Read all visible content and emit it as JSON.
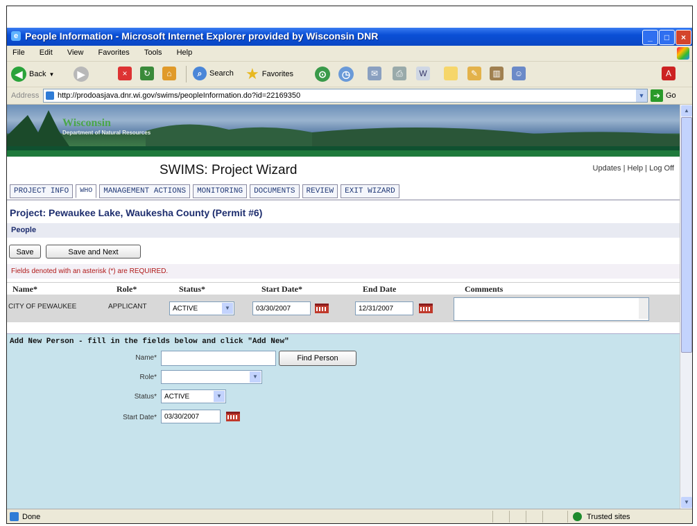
{
  "window": {
    "title": "People Information - Microsoft Internet Explorer provided by Wisconsin DNR",
    "menu": [
      "File",
      "Edit",
      "View",
      "Favorites",
      "Tools",
      "Help"
    ]
  },
  "toolbar": {
    "back_label": "Back",
    "search_label": "Search",
    "favorites_label": "Favorites"
  },
  "address": {
    "label": "Address",
    "url": "http://prodoasjava.dnr.wi.gov/swims/peopleInformation.do?id=22169350",
    "go_label": "Go"
  },
  "banner": {
    "title": "Wisconsin",
    "subtitle": "Department of Natural Resources"
  },
  "page": {
    "wizard_title": "SWIMS: Project Wizard",
    "links": [
      "Updates",
      "Help",
      "Log Off"
    ],
    "tabs": [
      "PROJECT INFO",
      "WHO",
      "MANAGEMENT ACTIONS",
      "MONITORING",
      "DOCUMENTS",
      "REVIEW",
      "EXIT WIZARD"
    ],
    "active_tab": "WHO",
    "project": "Project: Pewaukee Lake, Waukesha County (Permit #6)",
    "section": "People",
    "save_label": "Save",
    "save_next_label": "Save and Next",
    "required_note": "Fields denoted with an asterisk (*) are REQUIRED."
  },
  "people_table": {
    "columns": [
      "Name*",
      "Role*",
      "Status*",
      "Start Date*",
      "End Date",
      "Comments"
    ],
    "rows": [
      {
        "name": "CITY OF PEWAUKEE",
        "role": "APPLICANT",
        "status": "ACTIVE",
        "start": "03/30/2007",
        "end": "12/31/2007",
        "comments": ""
      }
    ]
  },
  "add_new": {
    "heading": "Add New Person - fill in the fields below and click \"Add New\"",
    "name_label": "Name*",
    "find_label": "Find Person",
    "role_label": "Role*",
    "status_label": "Status*",
    "status_value": "ACTIVE",
    "start_label": "Start Date*",
    "start_value": "03/30/2007"
  },
  "statusbar": {
    "text": "Done",
    "zone": "Trusted sites"
  }
}
